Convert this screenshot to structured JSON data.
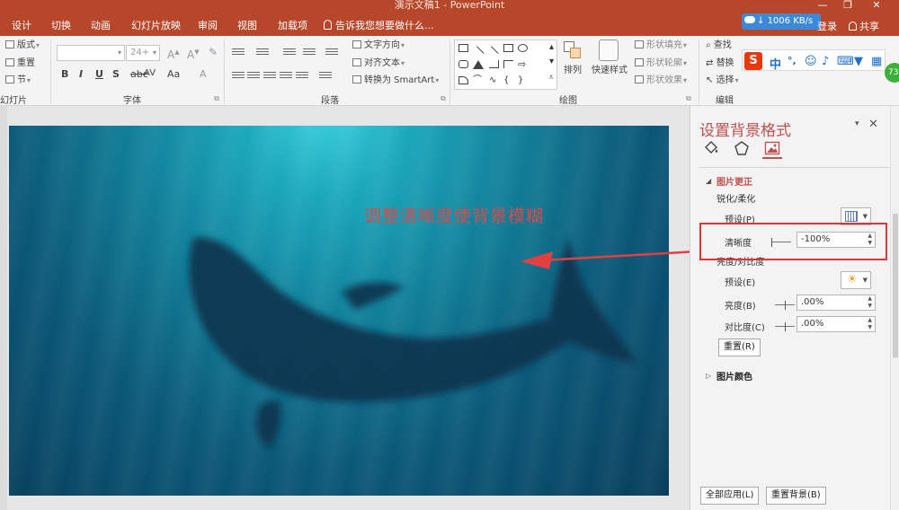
{
  "window": {
    "title": "演示文稿1 - PowerPoint",
    "login": "登录",
    "share": "共享",
    "speed": "1006 KB/s"
  },
  "tabs": [
    "设计",
    "切换",
    "动画",
    "幻灯片放映",
    "审阅",
    "视图",
    "加载项"
  ],
  "tell_me": "告诉我您想要做什么...",
  "ribbon": {
    "slides": {
      "layout": "版式",
      "reset": "重置",
      "section": "节",
      "label": "幻灯片"
    },
    "font": {
      "size": "24+",
      "label": "字体",
      "bold": "B",
      "italic": "I",
      "underline": "U",
      "strike": "S",
      "spacing": "AV",
      "case": "Aa"
    },
    "paragraph": {
      "text_direction": "文字方向",
      "align_text": "对齐文本",
      "smartart": "转换为 SmartArt",
      "label": "段落"
    },
    "drawing": {
      "arrange": "排列",
      "quick_styles": "快速样式",
      "shape_fill": "形状填充",
      "shape_outline": "形状轮廓",
      "shape_effects": "形状效果",
      "label": "绘图"
    },
    "editing": {
      "find": "查找",
      "replace": "替换",
      "select": "选择",
      "label": "编辑"
    },
    "ime": {
      "logo": "S",
      "mode": "中",
      "badge": "73"
    }
  },
  "slide": {
    "annotation": "调整清晰度使背景模糊"
  },
  "pane": {
    "title": "设置背景格式",
    "picture_corrections": "图片更正",
    "sharpen_soften": "锐化/柔化",
    "presets": "预设(P)",
    "sharpness_label": "清晰度",
    "sharpness_value": "-100%",
    "brightness_contrast": "亮度/对比度",
    "presets_e": "预设(E)",
    "brightness_label": "亮度(B)",
    "brightness_value": ".00%",
    "contrast_label": "对比度(C)",
    "contrast_value": ".00%",
    "reset": "重置(R)",
    "picture_color": "图片颜色",
    "apply_all": "全部应用(L)",
    "reset_background": "重置背景(B)"
  }
}
